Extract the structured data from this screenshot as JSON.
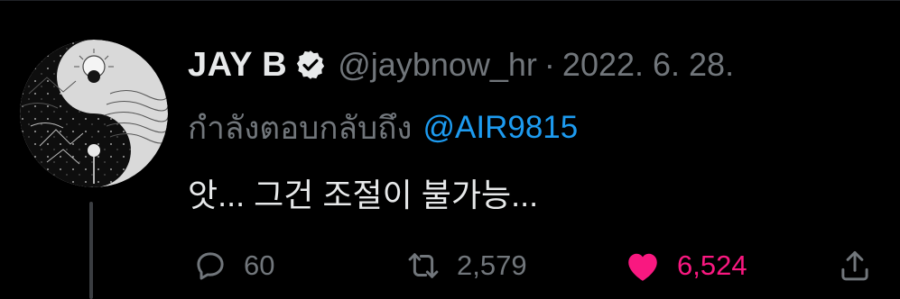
{
  "tweet": {
    "display_name": "JAY B",
    "handle": "@jaybnow_hr",
    "separator": "·",
    "date": "2022. 6. 28.",
    "reply_prefix": "กำลังตอบกลับถึง",
    "mention": "@AIR9815",
    "text": "앗... 그건 조절이 불가능..."
  },
  "actions": {
    "reply": {
      "icon": "reply-bubble-icon",
      "count": "60"
    },
    "retweet": {
      "icon": "retweet-icon",
      "count": "2,579"
    },
    "like": {
      "icon": "heart-filled-icon",
      "count": "6,524",
      "liked": true
    },
    "share": {
      "icon": "share-icon"
    }
  },
  "colors": {
    "background": "#000000",
    "primary_text": "#e7e9ea",
    "secondary_text": "#71767b",
    "mention": "#1d9bf0",
    "like": "#f91880",
    "thread_line": "#3a3d41"
  }
}
